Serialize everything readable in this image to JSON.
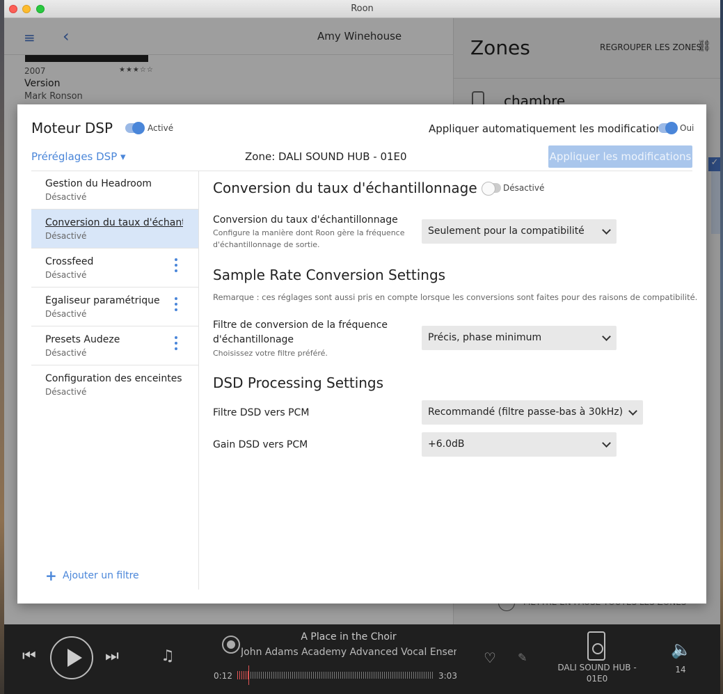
{
  "window": {
    "title": "Roon"
  },
  "background_app": {
    "artist_title": "Amy Winehouse",
    "album": {
      "year": "2007",
      "stars": "★★★☆☆",
      "name": "Version",
      "artist": "Mark Ronson"
    },
    "zones": {
      "title": "Zones",
      "regroup_label": "REGROUPER LES ZONES",
      "first_zone": "chambre",
      "pause_all": "METTRE EN PAUSE TOUTES LES ZONES"
    }
  },
  "player": {
    "track": "A Place in the Choir",
    "artist": "John Adams Academy Advanced Vocal Ensemble",
    "time_current": "0:12",
    "time_total": "3:03",
    "zone_name": "DALI SOUND HUB - 01E0",
    "volume": "14"
  },
  "dsp": {
    "title": "Moteur DSP",
    "active_label": "Activé",
    "auto_apply_label": "Appliquer automatiquement les modifications",
    "auto_apply_value": "Oui",
    "presets_label": "Préréglages DSP ▾",
    "zone_label": "Zone: DALI SOUND HUB - 01E0",
    "apply_button": "Appliquer les modifications",
    "filters": [
      {
        "name": "Gestion du Headroom",
        "state": "Désactivé",
        "selected": false,
        "menu": false
      },
      {
        "name": "Conversion du taux d'échantillonnage",
        "state": "Désactivé",
        "selected": true,
        "menu": false
      },
      {
        "name": "Crossfeed",
        "state": "Désactivé",
        "selected": false,
        "menu": true
      },
      {
        "name": "Égaliseur paramétrique",
        "state": "Désactivé",
        "selected": false,
        "menu": true
      },
      {
        "name": "Presets Audeze",
        "state": "Désactivé",
        "selected": false,
        "menu": true
      },
      {
        "name": "Configuration des enceintes",
        "state": "Désactivé",
        "selected": false,
        "menu": false
      }
    ],
    "add_filter": "Ajouter un filtre",
    "content": {
      "heading": "Conversion du taux d'échantillonnage",
      "heading_state": "Désactivé",
      "src_mode": {
        "label": "Conversion du taux d'échantillonnage",
        "description": "Configure la manière dont Roon gère la fréquence d'échantillonnage de sortie.",
        "value": "Seulement pour la compatibilité"
      },
      "src_settings_heading": "Sample Rate Conversion Settings",
      "src_note": "Remarque : ces réglages sont aussi pris en compte lorsque les conversions sont faites pour des raisons de compatibilité.",
      "src_filter": {
        "label": "Filtre de conversion de la fréquence d'échantillonage",
        "description": "Choisissez votre filtre préféré.",
        "value": "Précis, phase minimum"
      },
      "dsd_heading": "DSD Processing Settings",
      "dsd_filter": {
        "label": "Filtre DSD vers PCM",
        "value": "Recommandé (filtre passe-bas à 30kHz)"
      },
      "dsd_gain": {
        "label": "Gain DSD vers PCM",
        "value": "+6.0dB"
      }
    }
  },
  "colors": {
    "accent": "#4a86d9",
    "selected_row": "#d8e6f8",
    "apply_disabled": "#a9c6ec"
  }
}
